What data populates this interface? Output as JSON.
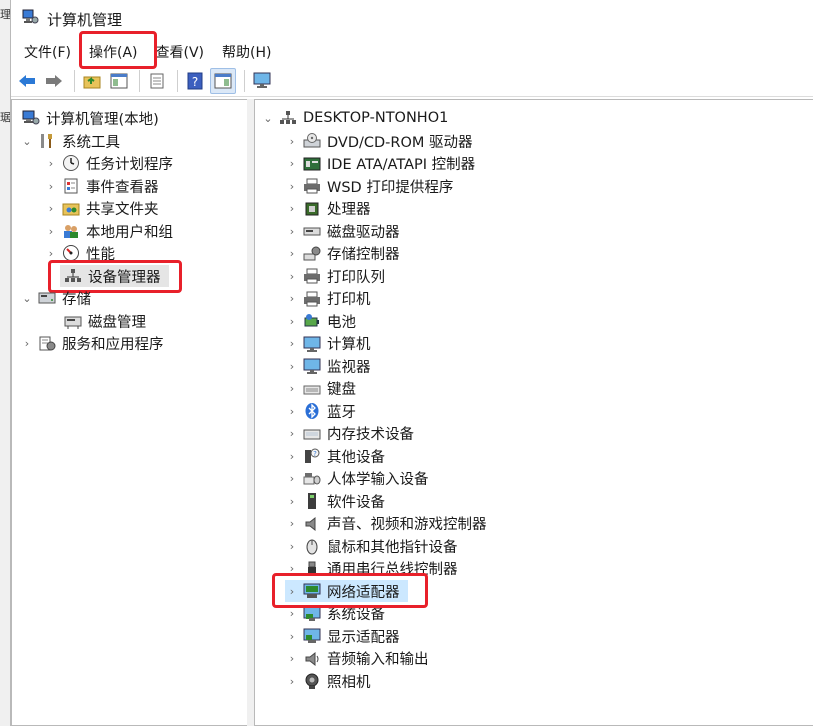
{
  "left_edge": {
    "top_char": "理",
    "mid_char": "琚"
  },
  "window": {
    "title": "计算机管理"
  },
  "menu": [
    {
      "label": "文件(F)"
    },
    {
      "label": "操作(A)"
    },
    {
      "label": "查看(V)"
    },
    {
      "label": "帮助(H)"
    }
  ],
  "toolbar": [
    "back-arrow-icon",
    "forward-arrow-icon",
    "folder-up-icon",
    "show-hide-console-tree-icon",
    "export-list-icon",
    "help-icon",
    "action-pane-icon",
    "monitor-icon"
  ],
  "left_tree": {
    "root": "计算机管理(本地)",
    "system_tools": "系统工具",
    "task_scheduler": "任务计划程序",
    "event_viewer": "事件查看器",
    "shared_folders": "共享文件夹",
    "local_users": "本地用户和组",
    "performance": "性能",
    "device_manager": "设备管理器",
    "storage": "存储",
    "disk_management": "磁盘管理",
    "services_apps": "服务和应用程序"
  },
  "right_tree": {
    "computer_name": "DESKTOP-NTONHO1",
    "categories": [
      {
        "label": "DVD/CD-ROM 驱动器",
        "icon": "dvd-drive-icon"
      },
      {
        "label": "IDE ATA/ATAPI 控制器",
        "icon": "ide-controller-icon"
      },
      {
        "label": "WSD 打印提供程序",
        "icon": "printer-icon"
      },
      {
        "label": "处理器",
        "icon": "processor-icon"
      },
      {
        "label": "磁盘驱动器",
        "icon": "disk-drive-icon"
      },
      {
        "label": "存储控制器",
        "icon": "storage-controller-icon"
      },
      {
        "label": "打印队列",
        "icon": "print-queue-icon"
      },
      {
        "label": "打印机",
        "icon": "printer-icon"
      },
      {
        "label": "电池",
        "icon": "battery-icon"
      },
      {
        "label": "计算机",
        "icon": "computer-icon"
      },
      {
        "label": "监视器",
        "icon": "monitor-icon"
      },
      {
        "label": "键盘",
        "icon": "keyboard-icon"
      },
      {
        "label": "蓝牙",
        "icon": "bluetooth-icon"
      },
      {
        "label": "内存技术设备",
        "icon": "memory-device-icon"
      },
      {
        "label": "其他设备",
        "icon": "other-devices-icon"
      },
      {
        "label": "人体学输入设备",
        "icon": "hid-icon"
      },
      {
        "label": "软件设备",
        "icon": "software-device-icon"
      },
      {
        "label": "声音、视频和游戏控制器",
        "icon": "speaker-icon"
      },
      {
        "label": "鼠标和其他指针设备",
        "icon": "mouse-icon"
      },
      {
        "label": "通用串行总线控制器",
        "icon": "usb-icon"
      },
      {
        "label": "网络适配器",
        "icon": "network-adapter-icon"
      },
      {
        "label": "系统设备",
        "icon": "system-device-icon"
      },
      {
        "label": "显示适配器",
        "icon": "display-adapter-icon"
      },
      {
        "label": "音频输入和输出",
        "icon": "audio-io-icon"
      },
      {
        "label": "照相机",
        "icon": "camera-icon"
      }
    ]
  },
  "colors": {
    "highlight_box": "#e8202a",
    "selection": "#cce8ff",
    "accent": "#2b79d6"
  }
}
